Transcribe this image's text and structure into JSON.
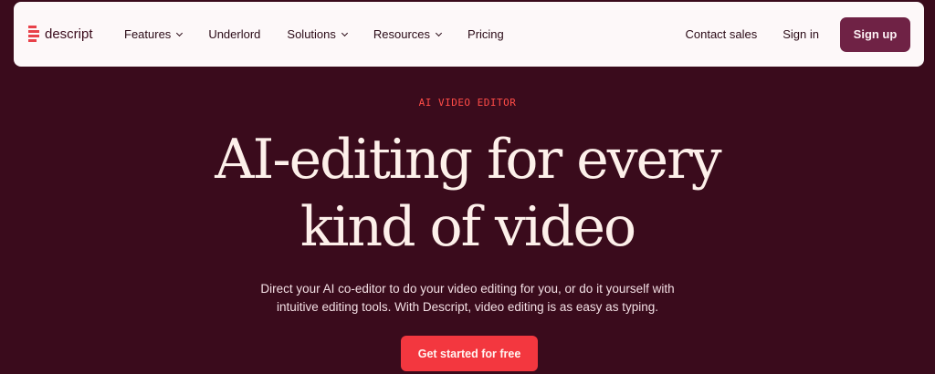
{
  "brand": {
    "name": "descript",
    "accent_color": "#6f2245",
    "cta_color": "#f3373f",
    "background_color": "#3a0b1c"
  },
  "nav": {
    "items": [
      {
        "label": "Features",
        "has_dropdown": true
      },
      {
        "label": "Underlord",
        "has_dropdown": false
      },
      {
        "label": "Solutions",
        "has_dropdown": true
      },
      {
        "label": "Resources",
        "has_dropdown": true
      },
      {
        "label": "Pricing",
        "has_dropdown": false
      }
    ],
    "contact_label": "Contact sales",
    "signin_label": "Sign in",
    "signup_label": "Sign up"
  },
  "hero": {
    "eyebrow": "AI VIDEO EDITOR",
    "headline_line1": "AI-editing for every",
    "headline_line2": "kind of video",
    "subtext_line1": "Direct your AI co-editor to do your video editing for you, or do it yourself with",
    "subtext_line2": "intuitive editing tools. With Descript, video editing is as easy as typing.",
    "cta_label": "Get started for free"
  }
}
